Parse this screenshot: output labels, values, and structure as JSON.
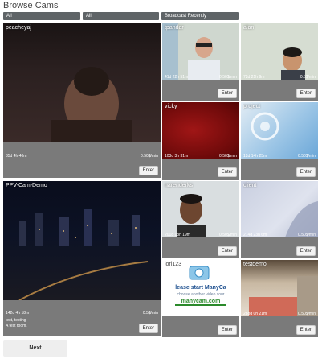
{
  "page": {
    "title": "Browse Cams"
  },
  "filters": [
    "All",
    "All",
    "Broadcast Recently"
  ],
  "tiles": [
    {
      "name": "peacheyaj",
      "duration": "35d 4h 40m",
      "rate": "0.50$/min",
      "enter": "Enter"
    },
    {
      "name": "tpandar",
      "duration": "41d 22h 51m",
      "rate": "0.50$/min",
      "enter": "Enter"
    },
    {
      "name": "alan",
      "duration": "72d 21h 9m",
      "rate": "0.5$/min",
      "enter": "Enter"
    },
    {
      "name": "vicky",
      "duration": "103d 3h 31m",
      "rate": "0.50$/min",
      "enter": "Enter"
    },
    {
      "name": "project",
      "duration": "12d 14h 25m",
      "rate": "0.50$/min",
      "enter": "Enter"
    },
    {
      "name": "PPV-Cam-Demo",
      "duration": "142d 4h 18m",
      "rate": "0.5$/min",
      "desc_line1": "test, testing",
      "desc_line2": "A test room.",
      "enter": "Enter"
    },
    {
      "name": "narenderks",
      "duration": "201d 18h 19m",
      "rate": "0.50$/min",
      "enter": "Enter"
    },
    {
      "name": "client",
      "duration": "214d 23h 6m",
      "rate": "0.50$/min",
      "enter": "Enter"
    },
    {
      "name": "lori123",
      "duration": "240d 19h 47m",
      "rate": "0.50$/min",
      "enter": "Enter",
      "overlay_line1": "lease start ManyCa",
      "overlay_line2": "choose another video sour",
      "overlay_brand": "manycam.com"
    },
    {
      "name": "testdemo",
      "duration": "288d 0h 21m",
      "rate": "0.50$/min",
      "enter": "Enter"
    }
  ],
  "pagination": {
    "next": "Next"
  }
}
